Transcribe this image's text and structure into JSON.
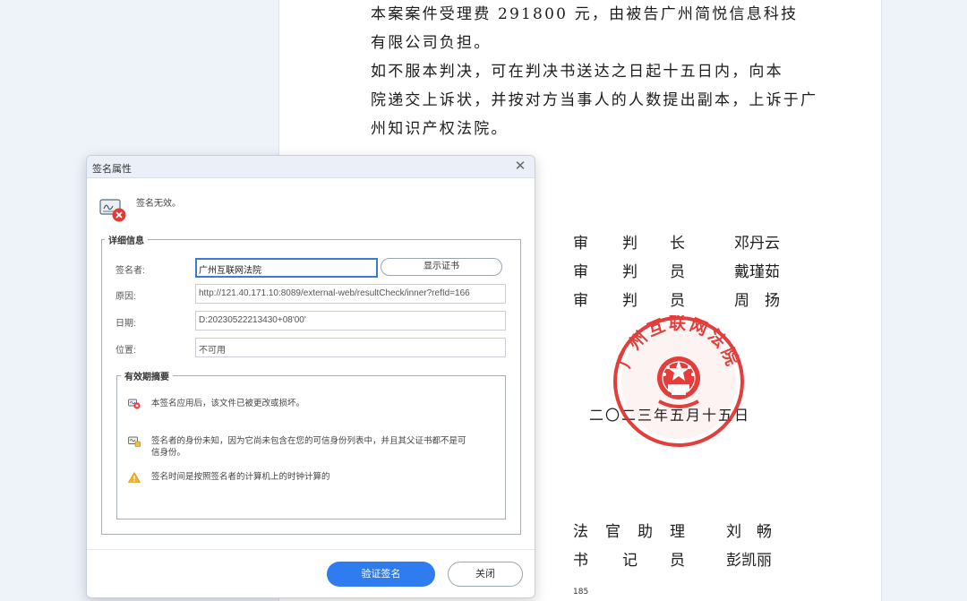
{
  "document": {
    "paragraph_1": [
      "本案案件受理费 291800 元，由被告广州简悦信息科技",
      "有限公司负担。"
    ],
    "paragraph_2": [
      "如不服本判决，可在判决书送达之日起十五日内，向本",
      "院递交上诉状，并按对方当事人的人数提出副本，上诉于广",
      "州知识产权法院。"
    ],
    "judges": [
      {
        "c1": "审",
        "c2": "判",
        "c3": "长",
        "name": "邓丹云"
      },
      {
        "c1": "审",
        "c2": "判",
        "c3": "员",
        "name": "戴瑾茹"
      },
      {
        "c1": "审",
        "c2": "判",
        "c3": "员",
        "name": "周　扬"
      }
    ],
    "date": "二〇二三年五月十五日",
    "assistant": {
      "role": [
        "法",
        "官",
        "助",
        "理"
      ],
      "name": "刘　畅"
    },
    "clerk": {
      "role": [
        "书",
        "记",
        "员"
      ],
      "name": "彭凯丽"
    },
    "page_number": "185",
    "seal_text": "广州互联网法院",
    "seal_color": "#e02a26"
  },
  "dialog": {
    "title": "签名属性",
    "status_text": "签名无效。",
    "status_icon": "invalid-signature-icon",
    "details_legend": "详细信息",
    "signer_label": "签名者:",
    "signer_value": "广州互联网法院",
    "show_cert_label": "显示证书",
    "reason_label": "原因:",
    "reason_value": "http://121.40.171.10:8089/external-web/resultCheck/inner?refId=166",
    "date_label": "日期:",
    "date_value": "D:20230522213430+08'00'",
    "location_label": "位置:",
    "location_value": "不可用",
    "summary_legend": "有效期摘要",
    "summary": [
      {
        "icon": "modified-document-icon",
        "text": "本签名应用后，该文件已被更改或损坏。"
      },
      {
        "icon": "unknown-identity-icon",
        "text_line1": "签名者的身份未知，因为它尚未包含在您的可信身份列表中，并且其父证书都不是可",
        "text_line2": "信身份。"
      },
      {
        "icon": "warning-icon",
        "text": "签名时间是按照签名者的计算机上的时钟计算的"
      }
    ],
    "verify_button": "验证签名",
    "close_button": "关闭",
    "accent_color": "#2f7cf0"
  }
}
